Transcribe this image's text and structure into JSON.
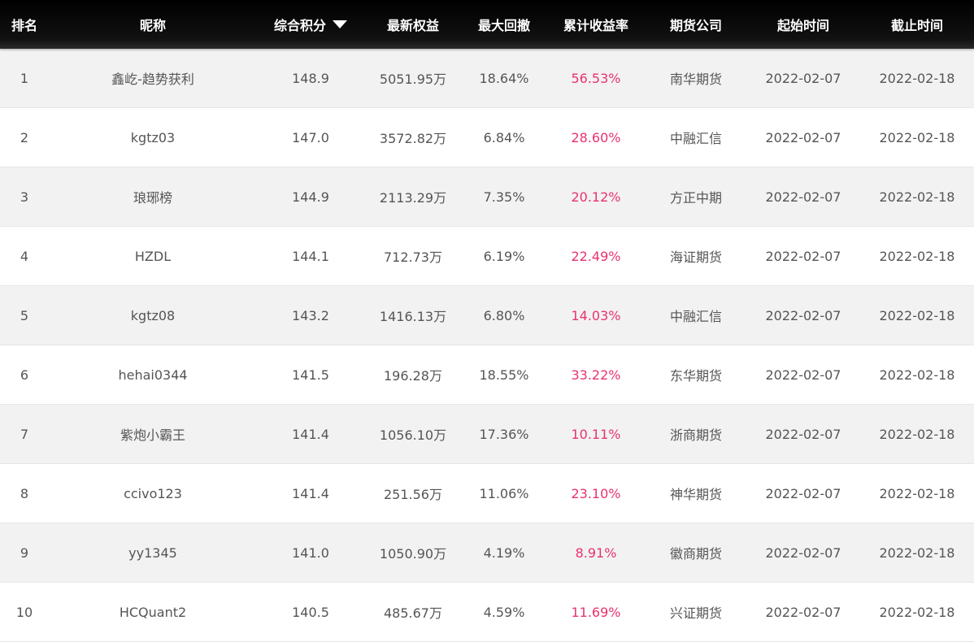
{
  "header": {
    "rank": "排名",
    "nickname": "昵称",
    "score": "综合积分",
    "equity": "最新权益",
    "drawdown": "最大回撤",
    "return": "累计收益率",
    "company": "期货公司",
    "start": "起始时间",
    "end": "截止时间"
  },
  "sort_icon": "triangle-down-icon",
  "colors": {
    "header_bg": "#000000",
    "return_text": "#e8336d",
    "row_alt": "#f2f2f2"
  },
  "rows": [
    {
      "rank": "1",
      "nickname": "鑫屹-趋势获利",
      "score": "148.9",
      "equity": "5051.95万",
      "drawdown": "18.64%",
      "return": "56.53%",
      "company": "南华期货",
      "start": "2022-02-07",
      "end": "2022-02-18"
    },
    {
      "rank": "2",
      "nickname": "kgtz03",
      "score": "147.0",
      "equity": "3572.82万",
      "drawdown": "6.84%",
      "return": "28.60%",
      "company": "中融汇信",
      "start": "2022-02-07",
      "end": "2022-02-18"
    },
    {
      "rank": "3",
      "nickname": "琅琊榜",
      "score": "144.9",
      "equity": "2113.29万",
      "drawdown": "7.35%",
      "return": "20.12%",
      "company": "方正中期",
      "start": "2022-02-07",
      "end": "2022-02-18"
    },
    {
      "rank": "4",
      "nickname": "HZDL",
      "score": "144.1",
      "equity": "712.73万",
      "drawdown": "6.19%",
      "return": "22.49%",
      "company": "海证期货",
      "start": "2022-02-07",
      "end": "2022-02-18"
    },
    {
      "rank": "5",
      "nickname": "kgtz08",
      "score": "143.2",
      "equity": "1416.13万",
      "drawdown": "6.80%",
      "return": "14.03%",
      "company": "中融汇信",
      "start": "2022-02-07",
      "end": "2022-02-18"
    },
    {
      "rank": "6",
      "nickname": "hehai0344",
      "score": "141.5",
      "equity": "196.28万",
      "drawdown": "18.55%",
      "return": "33.22%",
      "company": "东华期货",
      "start": "2022-02-07",
      "end": "2022-02-18"
    },
    {
      "rank": "7",
      "nickname": "紫炮小霸王",
      "score": "141.4",
      "equity": "1056.10万",
      "drawdown": "17.36%",
      "return": "10.11%",
      "company": "浙商期货",
      "start": "2022-02-07",
      "end": "2022-02-18"
    },
    {
      "rank": "8",
      "nickname": "ccivo123",
      "score": "141.4",
      "equity": "251.56万",
      "drawdown": "11.06%",
      "return": "23.10%",
      "company": "神华期货",
      "start": "2022-02-07",
      "end": "2022-02-18"
    },
    {
      "rank": "9",
      "nickname": "yy1345",
      "score": "141.0",
      "equity": "1050.90万",
      "drawdown": "4.19%",
      "return": "8.91%",
      "company": "徽商期货",
      "start": "2022-02-07",
      "end": "2022-02-18"
    },
    {
      "rank": "10",
      "nickname": "HCQuant2",
      "score": "140.5",
      "equity": "485.67万",
      "drawdown": "4.59%",
      "return": "11.69%",
      "company": "兴证期货",
      "start": "2022-02-07",
      "end": "2022-02-18"
    }
  ]
}
